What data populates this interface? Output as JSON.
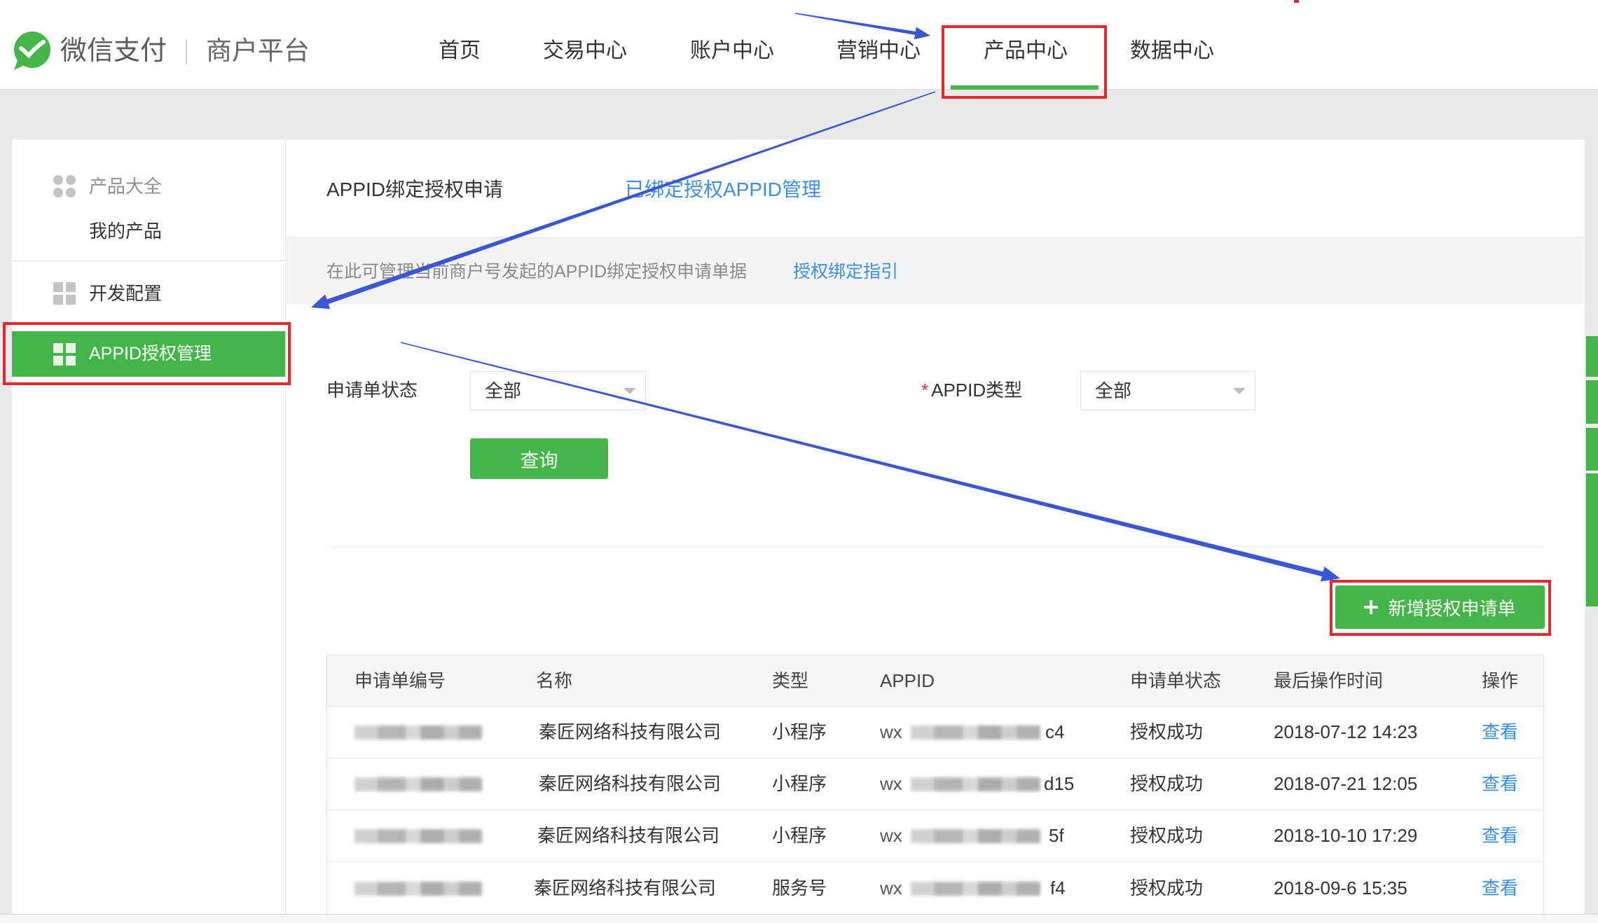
{
  "header": {
    "logo_icon": "wechat-pay-logo-icon",
    "brand": "微信支付",
    "platform": "商户平台",
    "nav": [
      {
        "label": "首页"
      },
      {
        "label": "交易中心"
      },
      {
        "label": "账户中心"
      },
      {
        "label": "营销中心"
      },
      {
        "label": "产品中心",
        "active": true
      },
      {
        "label": "数据中心"
      }
    ]
  },
  "sidebar": {
    "items": [
      {
        "label": "产品大全",
        "icon": "apps-icon"
      },
      {
        "label": "我的产品"
      },
      {
        "label": "开发配置",
        "icon": "grid-icon"
      },
      {
        "label": "APPID授权管理",
        "icon": "grid-icon",
        "active": true
      }
    ]
  },
  "main": {
    "tabs": [
      {
        "label": "APPID绑定授权申请",
        "active": true
      },
      {
        "label": "已绑定授权APPID管理"
      }
    ],
    "notice": {
      "text": "在此可管理当前商户号发起的APPID绑定授权申请单据",
      "link": "授权绑定指引"
    },
    "filters": [
      {
        "label": "申请单状态",
        "value": "全部"
      },
      {
        "label": "APPID类型",
        "required_mark": "*",
        "value": "全部"
      }
    ],
    "query_button": "查询",
    "new_button": "新增授权申请单",
    "table": {
      "columns": [
        "申请单编号",
        "名称",
        "类型",
        "APPID",
        "申请单状态",
        "最后操作时间",
        "操作"
      ],
      "rows": [
        {
          "name": "秦匠网络科技有限公司",
          "type": "小程序",
          "appid_prefix": "wx",
          "appid_suffix": "c4",
          "status": "授权成功",
          "updated_at": "2018-07-12 14:23",
          "action": "查看"
        },
        {
          "name": "秦匠网络科技有限公司",
          "type": "小程序",
          "appid_prefix": "wx",
          "appid_suffix": "d15",
          "status": "授权成功",
          "updated_at": "2018-07-21 12:05",
          "action": "查看"
        },
        {
          "name": "秦匠网络科技有限公司",
          "type": "小程序",
          "appid_prefix": "wx",
          "appid_suffix": "5f",
          "status": "授权成功",
          "updated_at": "2018-10-10 17:29",
          "action": "查看"
        },
        {
          "name": "秦匠网络科技有限公司",
          "type": "服务号",
          "appid_prefix": "wx",
          "appid_suffix": "f4",
          "status": "授权成功",
          "updated_at": "2018-09-6 15:35",
          "action": "查看"
        }
      ]
    }
  },
  "colors": {
    "brand_green": "#44b549",
    "link_blue": "#3b8fe3",
    "highlight_red": "#e8262d",
    "annotation_blue": "#3a56d4"
  }
}
